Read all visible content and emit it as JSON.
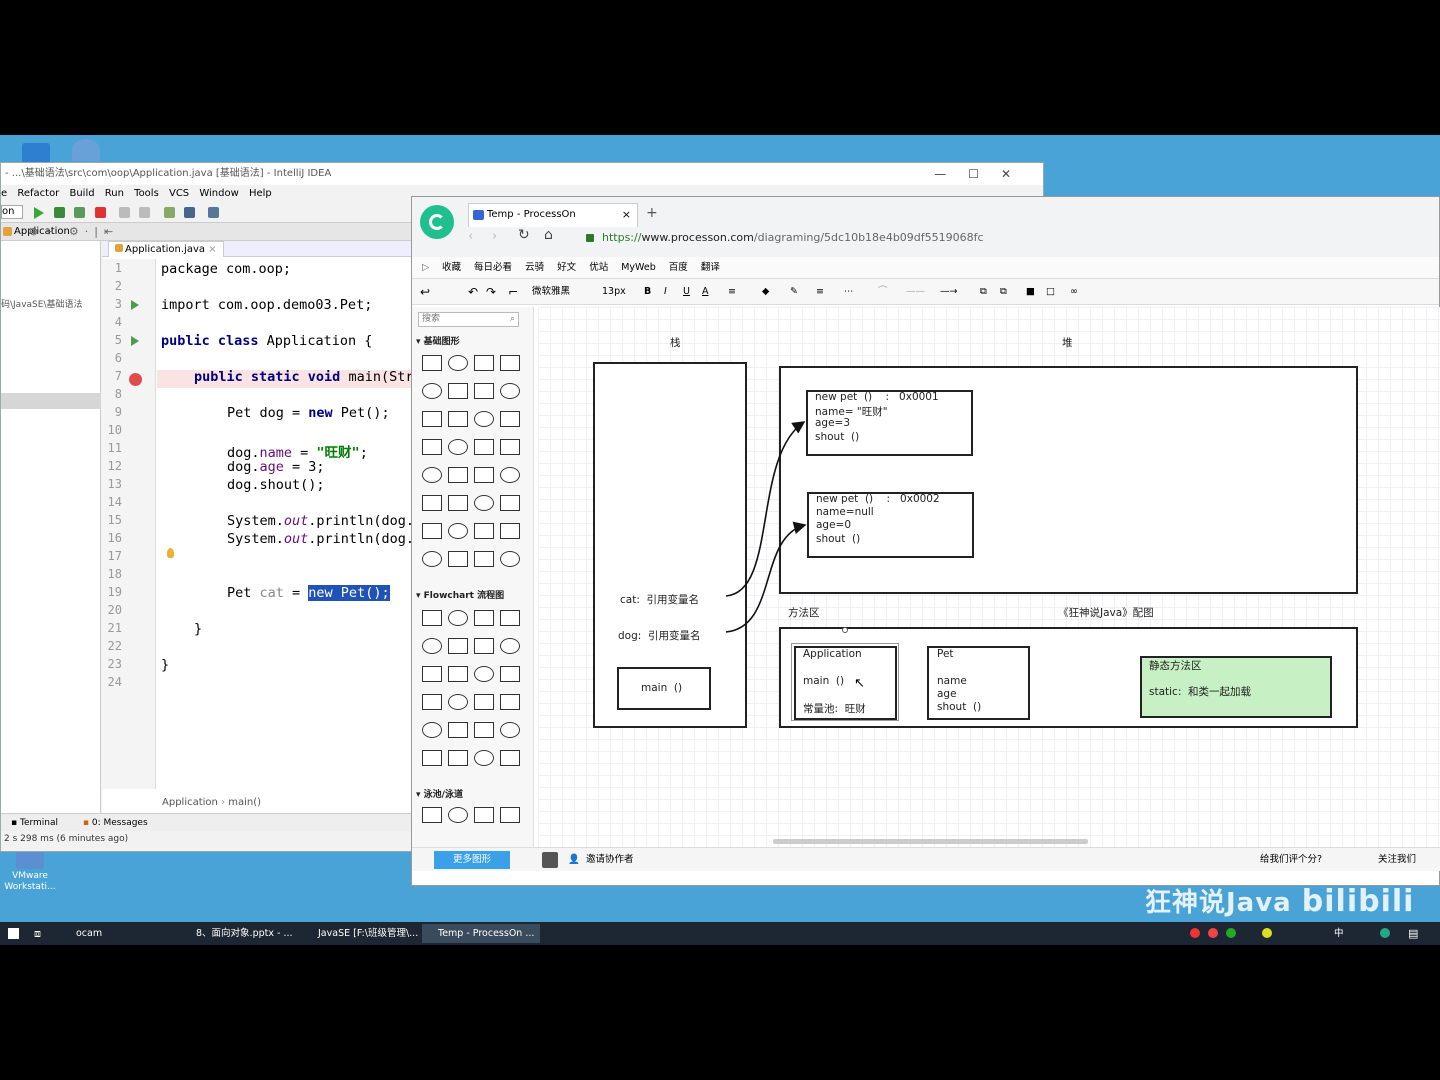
{
  "desktop": {
    "vmware_label": "VMware\nWorkstati..."
  },
  "idea": {
    "title": "- ...\\基础语法\\src\\com\\oop\\Application.java [基础语法] - IntelliJ IDEA",
    "menu": [
      "e",
      "Refactor",
      "Build",
      "Run",
      "Tools",
      "VCS",
      "Window",
      "Help"
    ],
    "run_config": "on",
    "nav_app": "Application",
    "project_path": "码\\JavaSE\\基础语法",
    "tab": "Application.java",
    "lines": [
      "1",
      "2",
      "3",
      "4",
      "5",
      "6",
      "7",
      "8",
      "9",
      "10",
      "11",
      "12",
      "13",
      "14",
      "15",
      "16",
      "17",
      "18",
      "19",
      "20",
      "21",
      "22",
      "23",
      "24"
    ],
    "code": {
      "l1": "package com.oop;",
      "l3": "import com.oop.demo03.Pet;",
      "l5_kw": "public class",
      "l5_rest": " Application {",
      "l7_kw": "public static void",
      "l7_rest": " main(Str",
      "l9_a": "Pet dog = ",
      "l9_kw": "new",
      "l9_b": " Pet();",
      "l11_a": "dog.",
      "l11_f": "name",
      "l11_b": " = ",
      "l11_s": "\"旺财\"",
      "l11_c": ";",
      "l12_a": "dog.",
      "l12_f": "age",
      "l12_b": " = 3;",
      "l13": "dog.shout();",
      "l15_a": "System.",
      "l15_i": "out",
      "l15_b": ".println(dog.",
      "l16_a": "System.",
      "l16_i": "out",
      "l16_b": ".println(dog.",
      "l19_a": "Pet ",
      "l19_v": "cat",
      "l19_b": " = ",
      "l19_sel": "new Pet();",
      "l21": "}",
      "l23": "}"
    },
    "breadcrumb": [
      "Application",
      "main()"
    ],
    "bottom_tools": [
      "Terminal",
      "0: Messages"
    ],
    "status": "2 s 298 ms (6 minutes ago)"
  },
  "browser": {
    "tab_title": "Temp - ProcessOn",
    "url_scheme": "https://",
    "url_host": "www.processon.com",
    "url_path": "/diagraming/5dc10b18e4b09df5519068fc",
    "bookmarks": [
      "收藏",
      "每日必看",
      "云骑",
      "好文",
      "优站",
      "MyWeb",
      "百度",
      "翻译"
    ],
    "font_name": "微软雅黑",
    "font_size": "13px",
    "search_placeholder": "搜索",
    "palette_sections": [
      "基础图形",
      "Flowchart 流程图",
      "泳池/泳道"
    ],
    "more_shapes": "更多图形",
    "invite": "邀请协作者",
    "rate": "给我们评个分?",
    "follow": "关注我们"
  },
  "diagram": {
    "stack_label": "栈",
    "heap_label": "堆",
    "method_area_label": "方法区",
    "credit_label": "《狂神说Java》配图",
    "obj1": [
      "new pet  ()    :   0x0001",
      "name= \"旺财\"",
      "age=3",
      "shout  ()"
    ],
    "obj2": [
      "new pet  ()    :   0x0002",
      "name=null",
      "age=0",
      "shout  ()"
    ],
    "cat_ref": "cat:  引用变量名",
    "dog_ref": "dog:  引用变量名",
    "main_frame": "main  ()",
    "application_box": [
      "Application",
      "main  ()",
      "常量池:  旺财"
    ],
    "pet_box": [
      "Pet",
      "name",
      "age",
      "shout  ()"
    ],
    "static_box": [
      "静态方法区",
      "static:  和类一起加载"
    ]
  },
  "watermark": "狂神说Java",
  "taskbar": {
    "items": [
      "ocam",
      "8、面向对象.pptx - ...",
      "JavaSE [F:\\班级管理\\...",
      "Temp - ProcessOn ..."
    ],
    "ime": "中"
  }
}
